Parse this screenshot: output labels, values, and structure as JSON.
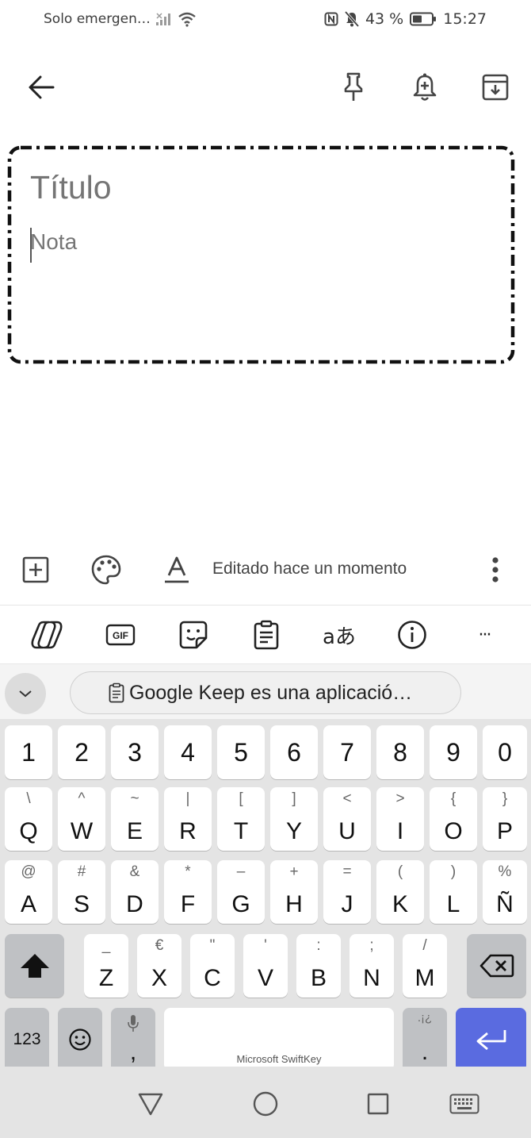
{
  "status_bar": {
    "carrier": "Solo emergen…",
    "battery": "43 %",
    "time": "15:27"
  },
  "app_bar": {
    "icons": [
      "back-arrow-icon",
      "pin-icon",
      "reminder-bell-icon",
      "archive-icon"
    ]
  },
  "note": {
    "title_placeholder": "Título",
    "body_placeholder": "Nota"
  },
  "note_toolbar": {
    "edited": "Editado hace un momento"
  },
  "keyboard": {
    "toolbar_icons": [
      "copilot-icon",
      "gif-icon",
      "sticker-icon",
      "clipboard-icon",
      "translate-icon",
      "info-icon",
      "more-icon"
    ],
    "gif_label": "GIF",
    "translate_label": "aあ",
    "more_label": "···",
    "clipboard_suggestion": "Google Keep es una aplicació…",
    "number_row": [
      "1",
      "2",
      "3",
      "4",
      "5",
      "6",
      "7",
      "8",
      "9",
      "0"
    ],
    "row1": [
      {
        "main": "Q",
        "alt": "\\"
      },
      {
        "main": "W",
        "alt": "^"
      },
      {
        "main": "E",
        "alt": "~"
      },
      {
        "main": "R",
        "alt": "|"
      },
      {
        "main": "T",
        "alt": "["
      },
      {
        "main": "Y",
        "alt": "]"
      },
      {
        "main": "U",
        "alt": "<"
      },
      {
        "main": "I",
        "alt": ">"
      },
      {
        "main": "O",
        "alt": "{"
      },
      {
        "main": "P",
        "alt": "}"
      }
    ],
    "row2": [
      {
        "main": "A",
        "alt": "@"
      },
      {
        "main": "S",
        "alt": "#"
      },
      {
        "main": "D",
        "alt": "&"
      },
      {
        "main": "F",
        "alt": "*"
      },
      {
        "main": "G",
        "alt": "–"
      },
      {
        "main": "H",
        "alt": "+"
      },
      {
        "main": "J",
        "alt": "="
      },
      {
        "main": "K",
        "alt": "("
      },
      {
        "main": "L",
        "alt": ")"
      },
      {
        "main": "Ñ",
        "alt": "%"
      }
    ],
    "row3": [
      {
        "main": "Z",
        "alt": "_"
      },
      {
        "main": "X",
        "alt": "€"
      },
      {
        "main": "C",
        "alt": "\""
      },
      {
        "main": "V",
        "alt": "'"
      },
      {
        "main": "B",
        "alt": ":"
      },
      {
        "main": "N",
        "alt": ";"
      },
      {
        "main": "M",
        "alt": "/"
      }
    ],
    "numbers_key": "123",
    "comma_key": ",",
    "space_label": "Microsoft SwiftKey",
    "period_key": ".",
    "period_alt": ".¡¿"
  },
  "colors": {
    "accent_enter": "#5a6be0",
    "keyboard_bg": "#e4e4e4"
  }
}
